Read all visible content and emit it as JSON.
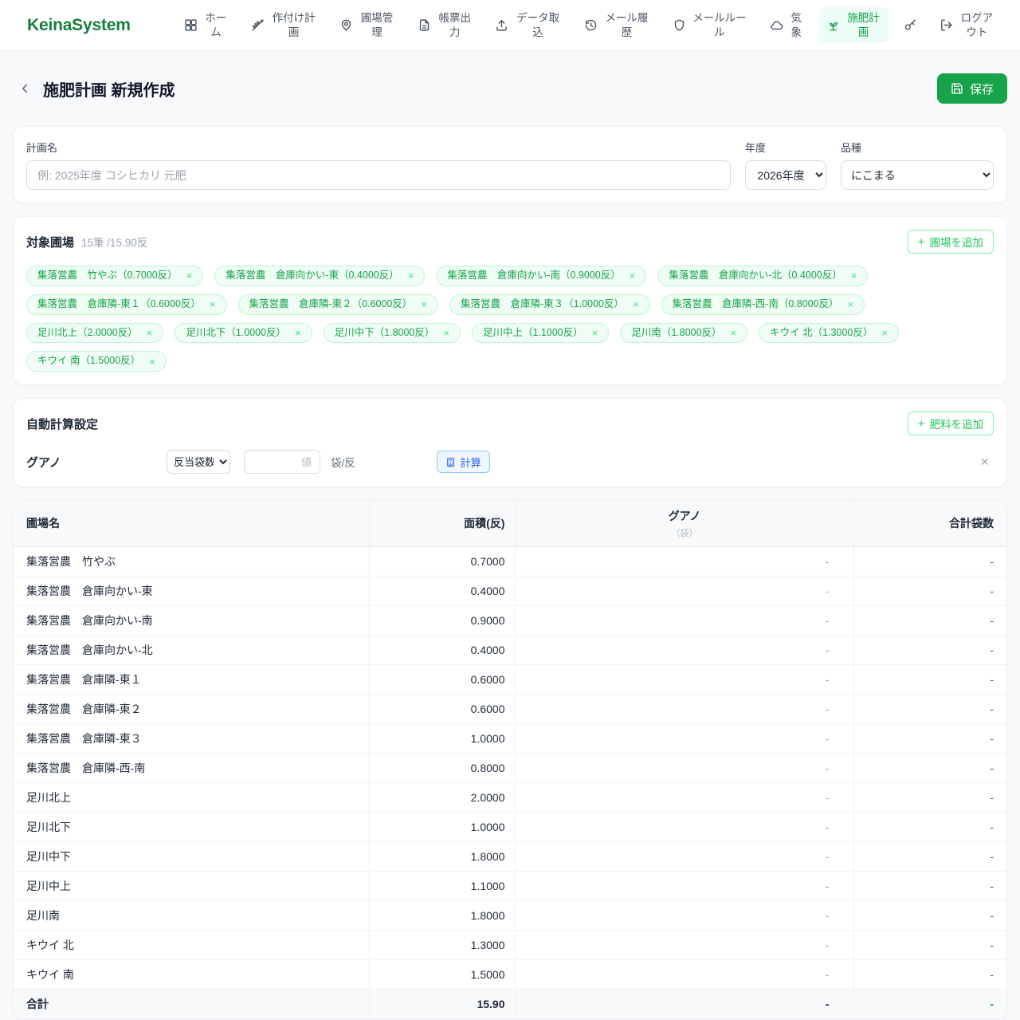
{
  "icons": {
    "plus": "+",
    "close": "×"
  },
  "colors": {
    "brand_green": "#15803d",
    "accent_green": "#16a34a",
    "tag_green_bg": "#f0fdf4",
    "calc_blue": "#2563eb",
    "page_bg": "#f8f9fb"
  },
  "nav": {
    "brand": "KeinaSystem",
    "items": [
      {
        "label": "ホーム",
        "icon": "grid-icon",
        "active": false
      },
      {
        "label": "作付け計画",
        "icon": "wheat-icon",
        "active": false
      },
      {
        "label": "圃場管理",
        "icon": "map-pin-icon",
        "active": false
      },
      {
        "label": "帳票出力",
        "icon": "document-icon",
        "active": false
      },
      {
        "label": "データ取込",
        "icon": "upload-icon",
        "active": false
      },
      {
        "label": "メール履歴",
        "icon": "history-icon",
        "active": false
      },
      {
        "label": "メールルール",
        "icon": "shield-icon",
        "active": false
      },
      {
        "label": "気象",
        "icon": "cloud-icon",
        "active": false
      },
      {
        "label": "施肥計画",
        "icon": "sprout-icon",
        "active": true
      }
    ],
    "logout_label": "ログアウト"
  },
  "header": {
    "title": "施肥計画 新規作成",
    "save_label": "保存"
  },
  "plan_form": {
    "name_label": "計画名",
    "name_placeholder": "例: 2025年度 コシヒカリ 元肥",
    "year_label": "年度",
    "year_value": "2026年度",
    "variety_label": "品種",
    "variety_value": "にこまる"
  },
  "fields_section": {
    "title": "対象圃場",
    "summary": "15筆 /15.90反",
    "add_button": "圃場を追加",
    "tags": [
      "集落営農　竹やぶ（0.7000反）",
      "集落営農　倉庫向かい-東（0.4000反）",
      "集落営農　倉庫向かい-南（0.9000反）",
      "集落営農　倉庫向かい-北（0.4000反）",
      "集落営農　倉庫隣-東１（0.6000反）",
      "集落営農　倉庫隣-東２（0.6000反）",
      "集落営農　倉庫隣-東３（1.0000反）",
      "集落営農　倉庫隣-西-南（0.8000反）",
      "足川北上（2.0000反）",
      "足川北下（1.0000反）",
      "足川中下（1.8000反）",
      "足川中上（1.1000反）",
      "足川南（1.8000反）",
      "キウイ 北（1.3000反）",
      "キウイ 南（1.5000反）"
    ]
  },
  "auto_calc": {
    "title": "自動計算設定",
    "add_button": "肥料を追加",
    "fertilizer_name": "グアノ",
    "mode_value": "反当袋数",
    "value_placeholder": "値",
    "unit": "袋/反",
    "calc_button": "計算"
  },
  "table": {
    "headers": {
      "field": "圃場名",
      "area": "面積(反)",
      "fertilizer": "グアノ",
      "fertilizer_unit": "（袋）",
      "total": "合計袋数"
    },
    "rows": [
      {
        "name": "集落営農　竹やぶ",
        "area": "0.7000",
        "fert": "-",
        "total": "-"
      },
      {
        "name": "集落営農　倉庫向かい-東",
        "area": "0.4000",
        "fert": "-",
        "total": "-"
      },
      {
        "name": "集落営農　倉庫向かい-南",
        "area": "0.9000",
        "fert": "-",
        "total": "-"
      },
      {
        "name": "集落営農　倉庫向かい-北",
        "area": "0.4000",
        "fert": "-",
        "total": "-"
      },
      {
        "name": "集落営農　倉庫隣-東１",
        "area": "0.6000",
        "fert": "-",
        "total": "-"
      },
      {
        "name": "集落営農　倉庫隣-東２",
        "area": "0.6000",
        "fert": "-",
        "total": "-"
      },
      {
        "name": "集落営農　倉庫隣-東３",
        "area": "1.0000",
        "fert": "-",
        "total": "-"
      },
      {
        "name": "集落営農　倉庫隣-西-南",
        "area": "0.8000",
        "fert": "-",
        "total": "-"
      },
      {
        "name": "足川北上",
        "area": "2.0000",
        "fert": "-",
        "total": "-"
      },
      {
        "name": "足川北下",
        "area": "1.0000",
        "fert": "-",
        "total": "-"
      },
      {
        "name": "足川中下",
        "area": "1.8000",
        "fert": "-",
        "total": "-"
      },
      {
        "name": "足川中上",
        "area": "1.1000",
        "fert": "-",
        "total": "-"
      },
      {
        "name": "足川南",
        "area": "1.8000",
        "fert": "-",
        "total": "-"
      },
      {
        "name": "キウイ 北",
        "area": "1.3000",
        "fert": "-",
        "total": "-"
      },
      {
        "name": "キウイ 南",
        "area": "1.5000",
        "fert": "-",
        "total": "-"
      }
    ],
    "footer": {
      "name": "合計",
      "area": "15.90",
      "fert": "-",
      "total": "-"
    }
  }
}
